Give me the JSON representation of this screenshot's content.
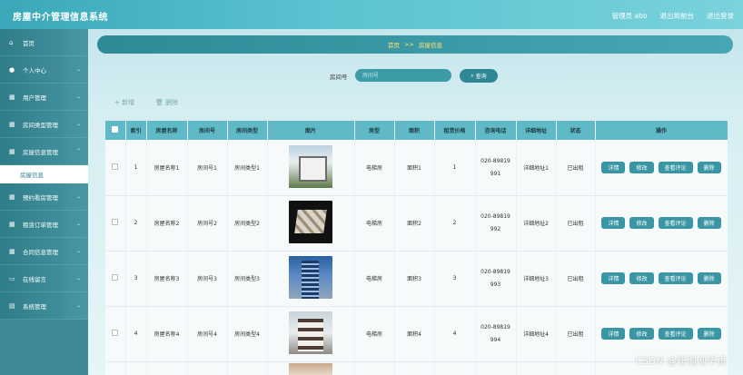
{
  "header": {
    "app_title": "房屋中介管理信息系统",
    "admin_label": "管理员 abo",
    "back_label": "退出到前台",
    "logout_label": "退出登录"
  },
  "sidebar": {
    "items": [
      {
        "label": "首页",
        "icon": "home-icon"
      },
      {
        "label": "个人中心",
        "icon": "user-icon"
      },
      {
        "label": "用户管理",
        "icon": "grid-icon"
      },
      {
        "label": "房间类型管理",
        "icon": "grid-icon"
      },
      {
        "label": "房屋信息管理",
        "icon": "grid-icon"
      },
      {
        "label": "预约看房管理",
        "icon": "grid-icon"
      },
      {
        "label": "租赁订单管理",
        "icon": "grid-icon"
      },
      {
        "label": "合同信息管理",
        "icon": "grid-icon"
      },
      {
        "label": "在线留言",
        "icon": "monitor-icon"
      },
      {
        "label": "系统管理",
        "icon": "chart-icon"
      }
    ],
    "sub_item": "房屋信息"
  },
  "breadcrumb": {
    "home": "首页",
    "sep": ">>",
    "current": "房屋信息"
  },
  "search": {
    "label": "房间号",
    "placeholder": "房间号",
    "button_label": "查询"
  },
  "toolbar": {
    "add_label": "+ 新增",
    "delete_label": "删除"
  },
  "table": {
    "headers": [
      "索引",
      "房屋名称",
      "房间号",
      "房间类型",
      "图片",
      "房型",
      "面积",
      "租赁价格",
      "咨询电话",
      "详细地址",
      "状态",
      "操作"
    ],
    "rows": [
      {
        "index": "1",
        "name": "房屋名称1",
        "room": "房间号1",
        "type": "房间类型1",
        "layout": "电梯房",
        "area": "面积1",
        "price": "1",
        "phone_a": "020-89819",
        "phone_b": "991",
        "address": "详细地址1",
        "status": "已出租"
      },
      {
        "index": "2",
        "name": "房屋名称2",
        "room": "房间号2",
        "type": "房间类型2",
        "layout": "电梯房",
        "area": "面积2",
        "price": "2",
        "phone_a": "020-89819",
        "phone_b": "992",
        "address": "详细地址2",
        "status": "已出租"
      },
      {
        "index": "3",
        "name": "房屋名称3",
        "room": "房间号3",
        "type": "房间类型3",
        "layout": "电梯房",
        "area": "面积3",
        "price": "3",
        "phone_a": "020-89819",
        "phone_b": "993",
        "address": "详细地址3",
        "status": "已出租"
      },
      {
        "index": "4",
        "name": "房屋名称4",
        "room": "房间号4",
        "type": "房间类型4",
        "layout": "电梯房",
        "area": "面积4",
        "price": "4",
        "phone_a": "020-89819",
        "phone_b": "994",
        "address": "详细地址4",
        "status": "已出租"
      }
    ],
    "actions": {
      "detail": "详情",
      "edit": "修改",
      "reviews": "查看评论",
      "delete": "删除"
    }
  },
  "watermark": "CSDN @粉泡泡毕设"
}
